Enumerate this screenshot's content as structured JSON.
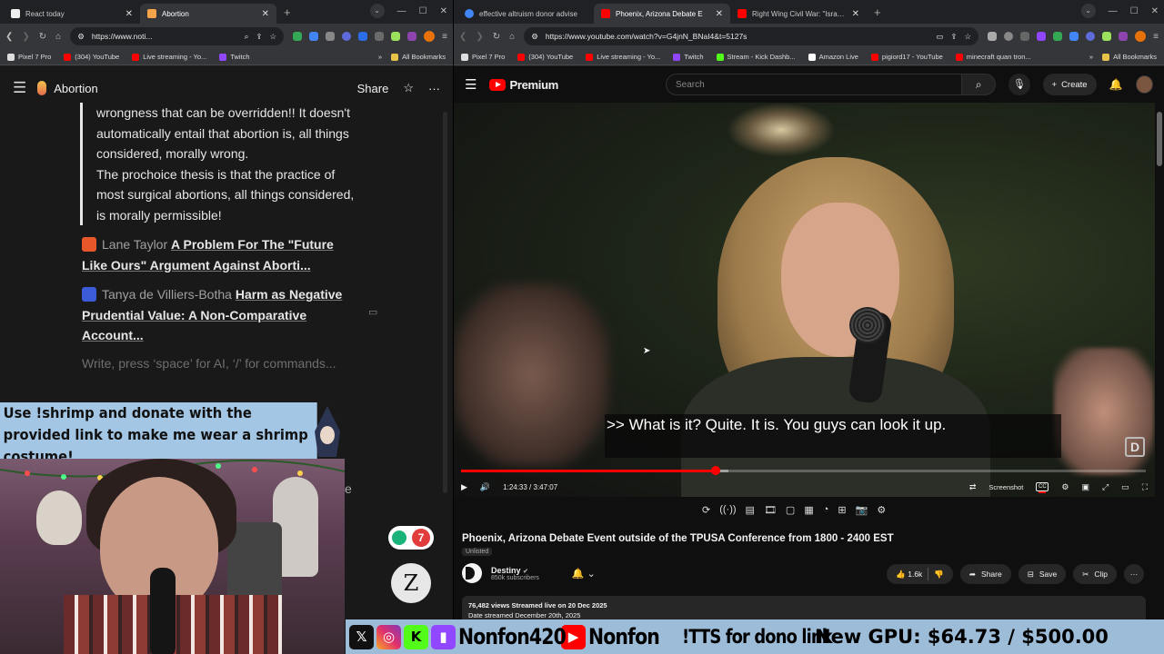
{
  "left_window": {
    "tabs": [
      {
        "label": "React today",
        "active": false,
        "color": "#eeeeee"
      },
      {
        "label": "Abortion",
        "active": true,
        "color": "#f4a54c"
      }
    ],
    "url": "https://www.noti...",
    "bookmarks": [
      "Pixel 7 Pro",
      "(304) YouTube",
      "Live streaming - Yo...",
      "Twitch"
    ],
    "all_bookmarks": "All Bookmarks",
    "page": {
      "title": "Abortion",
      "share": "Share",
      "quote_lines": [
        "wrongness that can be overridden!! It doesn't automatically entail that abortion is, all things considered, morally wrong.",
        "The prochoice thesis is that the practice of most surgical abortions, all things considered, is morally permissible!"
      ],
      "refs": [
        {
          "author": "Lane Taylor",
          "title": "A Problem For The \"Future Like Ours\" Argument Against Aborti...",
          "icon_color": "#e8572a"
        },
        {
          "author": "Tanya de Villiers-Botha",
          "title": "Harm as Negative Prudential Value: A Non-Comparative Account...",
          "icon_color": "#3b5bd9"
        }
      ],
      "placeholder": "Write, press ‘space’ for AI, ‘/’ for commands..."
    }
  },
  "stream_overlay": {
    "banner": "Use !shrimp and donate with the provided link to make me wear a shrimp costume!",
    "badge_count": "7",
    "bubble_letter": "Z",
    "fragment": "e",
    "ticker": {
      "twitch_name": "Nonfon420",
      "youtube_name": "Nonfon",
      "tts": "!TTS for dono link",
      "gpu": "New GPU: $64.73 / $500.00",
      "gpu_current": 64.73,
      "gpu_goal": 500.0
    }
  },
  "right_window": {
    "tabs": [
      {
        "label": "effective altruism donor advise",
        "active": false,
        "color": "#4285f4"
      },
      {
        "label": "Phoenix, Arizona Debate E",
        "active": true,
        "color": "#ff0000"
      },
      {
        "label": "Right Wing Civil War: \"Israel &",
        "active": false,
        "color": "#ff0000"
      }
    ],
    "url": "https://www.youtube.com/watch?v=G4jnN_BNaI4&t=5127s",
    "bookmarks": [
      "Pixel 7 Pro",
      "(304) YouTube",
      "Live streaming - Yo...",
      "Twitch",
      "Stream - Kick Dashb...",
      "Amazon Live",
      "pigiord17 - YouTube",
      "minecraft quan tron..."
    ],
    "all_bookmarks": "All Bookmarks",
    "youtube": {
      "logo": "Premium",
      "search_placeholder": "Search",
      "create": "Create",
      "caption_text": ">> What is it? Quite. It is. You guys can look it up.",
      "time": "1:24:33 / 3:47:07",
      "progress_fraction": 0.372,
      "loaded_fraction": 0.39,
      "screenshot_label": "Screenshot",
      "video_title": "Phoenix, Arizona Debate Event outside of the TPUSA Conference from 1800 - 2400 EST",
      "unlisted": "Unlisted",
      "channel": "Destiny",
      "subscribers": "850k subscribers",
      "likes": "1.6k",
      "share": "Share",
      "save": "Save",
      "clip": "Clip",
      "views_line": "76,482 views  Streamed live on 20 Dec 2025",
      "desc_line2": "Date streamed December 20th, 2025"
    }
  }
}
